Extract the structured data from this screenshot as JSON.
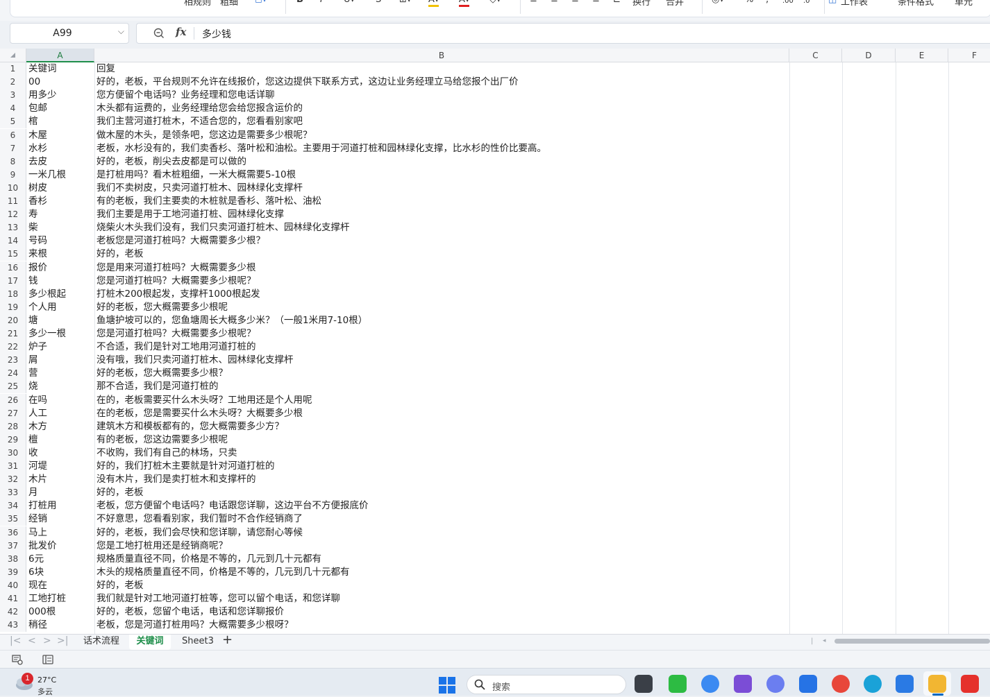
{
  "ribbon": {
    "items": [
      "相规则",
      "粗细",
      "B",
      "I",
      "≡",
      "≡",
      "≡",
      "≡",
      "换行",
      "合并",
      "%",
      "工作表",
      "条件格式",
      "单元"
    ]
  },
  "formula_bar": {
    "cell_ref": "A99",
    "fx": "fx",
    "content": "多少钱"
  },
  "columns": [
    "A",
    "B",
    "C",
    "D",
    "E",
    "F"
  ],
  "rows": [
    {
      "n": "1",
      "a": "关键词",
      "b": "回复"
    },
    {
      "n": "2",
      "a": "00",
      "b": "好的，老板，平台规则不允许在线报价，您这边提供下联系方式，这边让业务经理立马给您报个出厂价"
    },
    {
      "n": "3",
      "a": "用多少",
      "b": "您方便留个电话吗？业务经理和您电话详聊"
    },
    {
      "n": "4",
      "a": "包邮",
      "b": "木头都有运费的，业务经理给您会给您报含运价的"
    },
    {
      "n": "5",
      "a": "棺",
      "b": "我们主营河道打桩木，不适合您的，您看看别家吧"
    },
    {
      "n": "6",
      "a": "木屋",
      "b": "做木屋的木头，是领条吧，您这边是需要多少根呢？"
    },
    {
      "n": "7",
      "a": "水杉",
      "b": "老板，水杉没有的，我们卖香杉、落叶松和油松。主要用于河道打桩和园林绿化支撑，比水杉的性价比要高。"
    },
    {
      "n": "8",
      "a": "去皮",
      "b": "好的，老板，削尖去皮都是可以做的"
    },
    {
      "n": "9",
      "a": "一米几根",
      "b": "是打桩用吗？看木桩粗细，一米大概需要5-10根"
    },
    {
      "n": "10",
      "a": "树皮",
      "b": "我们不卖树皮，只卖河道打桩木、园林绿化支撑杆"
    },
    {
      "n": "11",
      "a": "香杉",
      "b": "有的老板，我们主要卖的木桩就是香杉、落叶松、油松"
    },
    {
      "n": "12",
      "a": "寿",
      "b": "我们主要是用于工地河道打桩、园林绿化支撑"
    },
    {
      "n": "13",
      "a": "柴",
      "b": "烧柴火木头我们没有，我们只卖河道打桩木、园林绿化支撑杆"
    },
    {
      "n": "14",
      "a": "号码",
      "b": "老板您是河道打桩吗？大概需要多少根？"
    },
    {
      "n": "15",
      "a": "来根",
      "b": "好的，老板"
    },
    {
      "n": "16",
      "a": "报价",
      "b": "您是用来河道打桩吗？大概需要多少根"
    },
    {
      "n": "17",
      "a": "钱",
      "b": "您是河道打桩吗？大概需要多少根呢？"
    },
    {
      "n": "18",
      "a": "多少根起",
      "b": "打桩木200根起发，支撑杆1000根起发"
    },
    {
      "n": "19",
      "a": "个人用",
      "b": "好的老板，您大概需要多少根呢"
    },
    {
      "n": "20",
      "a": "塘",
      "b": "鱼塘护坡可以的，您鱼塘周长大概多少米？（一般1米用7-10根）"
    },
    {
      "n": "21",
      "a": "多少一根",
      "b": "您是河道打桩吗？大概需要多少根呢？"
    },
    {
      "n": "22",
      "a": "炉子",
      "b": "不合适，我们是针对工地用河道打桩的"
    },
    {
      "n": "23",
      "a": "屑",
      "b": "没有哦，我们只卖河道打桩木、园林绿化支撑杆"
    },
    {
      "n": "24",
      "a": "营",
      "b": "好的老板，您大概需要多少根？"
    },
    {
      "n": "25",
      "a": "烧",
      "b": "那不合适，我们是河道打桩的"
    },
    {
      "n": "26",
      "a": "在吗",
      "b": "在的，老板需要买什么木头呀？工地用还是个人用呢"
    },
    {
      "n": "27",
      "a": "人工",
      "b": "在的老板，您是需要买什么木头呀？大概要多少根"
    },
    {
      "n": "28",
      "a": "木方",
      "b": "建筑木方和模板都有的，您大概需要多少方？"
    },
    {
      "n": "29",
      "a": "檀",
      "b": "有的老板，您这边需要多少根呢"
    },
    {
      "n": "30",
      "a": "收",
      "b": "不收购，我们有自己的林场，只卖"
    },
    {
      "n": "31",
      "a": "河堤",
      "b": "好的，我们打桩木主要就是针对河道打桩的"
    },
    {
      "n": "32",
      "a": "木片",
      "b": "没有木片，我们是卖打桩木和支撑杆的"
    },
    {
      "n": "33",
      "a": "月",
      "b": "好的，老板"
    },
    {
      "n": "34",
      "a": "打桩用",
      "b": "老板，您方便留个电话吗？电话跟您详聊，这边平台不方便报底价"
    },
    {
      "n": "35",
      "a": "经销",
      "b": "不好意思，您看看别家，我们暂时不合作经销商了"
    },
    {
      "n": "36",
      "a": "马上",
      "b": "好的，老板，我们会尽快和您详聊，请您耐心等候"
    },
    {
      "n": "37",
      "a": "批发价",
      "b": "您是工地打桩用还是经销商呢？"
    },
    {
      "n": "38",
      "a": "6元",
      "b": "规格质量直径不同，价格是不等的，几元到几十元都有"
    },
    {
      "n": "39",
      "a": "6块",
      "b": "木头的规格质量直径不同，价格是不等的，几元到几十元都有"
    },
    {
      "n": "40",
      "a": "现在",
      "b": "好的，老板"
    },
    {
      "n": "41",
      "a": "工地打桩",
      "b": "我们就是针对工地河道打桩等，您可以留个电话，和您详聊"
    },
    {
      "n": "42",
      "a": "000根",
      "b": "好的，老板，您留个电话，电话和您详聊报价"
    },
    {
      "n": "43",
      "a": "稍径",
      "b": "老板，您是河道打桩用吗？大概需要多少根呀？"
    }
  ],
  "sheet_tabs": [
    {
      "label": "话术流程",
      "active": false
    },
    {
      "label": "关键词",
      "active": true
    },
    {
      "label": "Sheet3",
      "active": false
    }
  ],
  "sheet_add": "+",
  "taskbar": {
    "weather_badge": "1",
    "temperature": "27°C",
    "condition": "多云",
    "search_label": "搜索"
  },
  "colors": {
    "accent": "#1e8e4a",
    "header_bg": "#f5f6f8",
    "grid_line": "#e3e6ea"
  }
}
